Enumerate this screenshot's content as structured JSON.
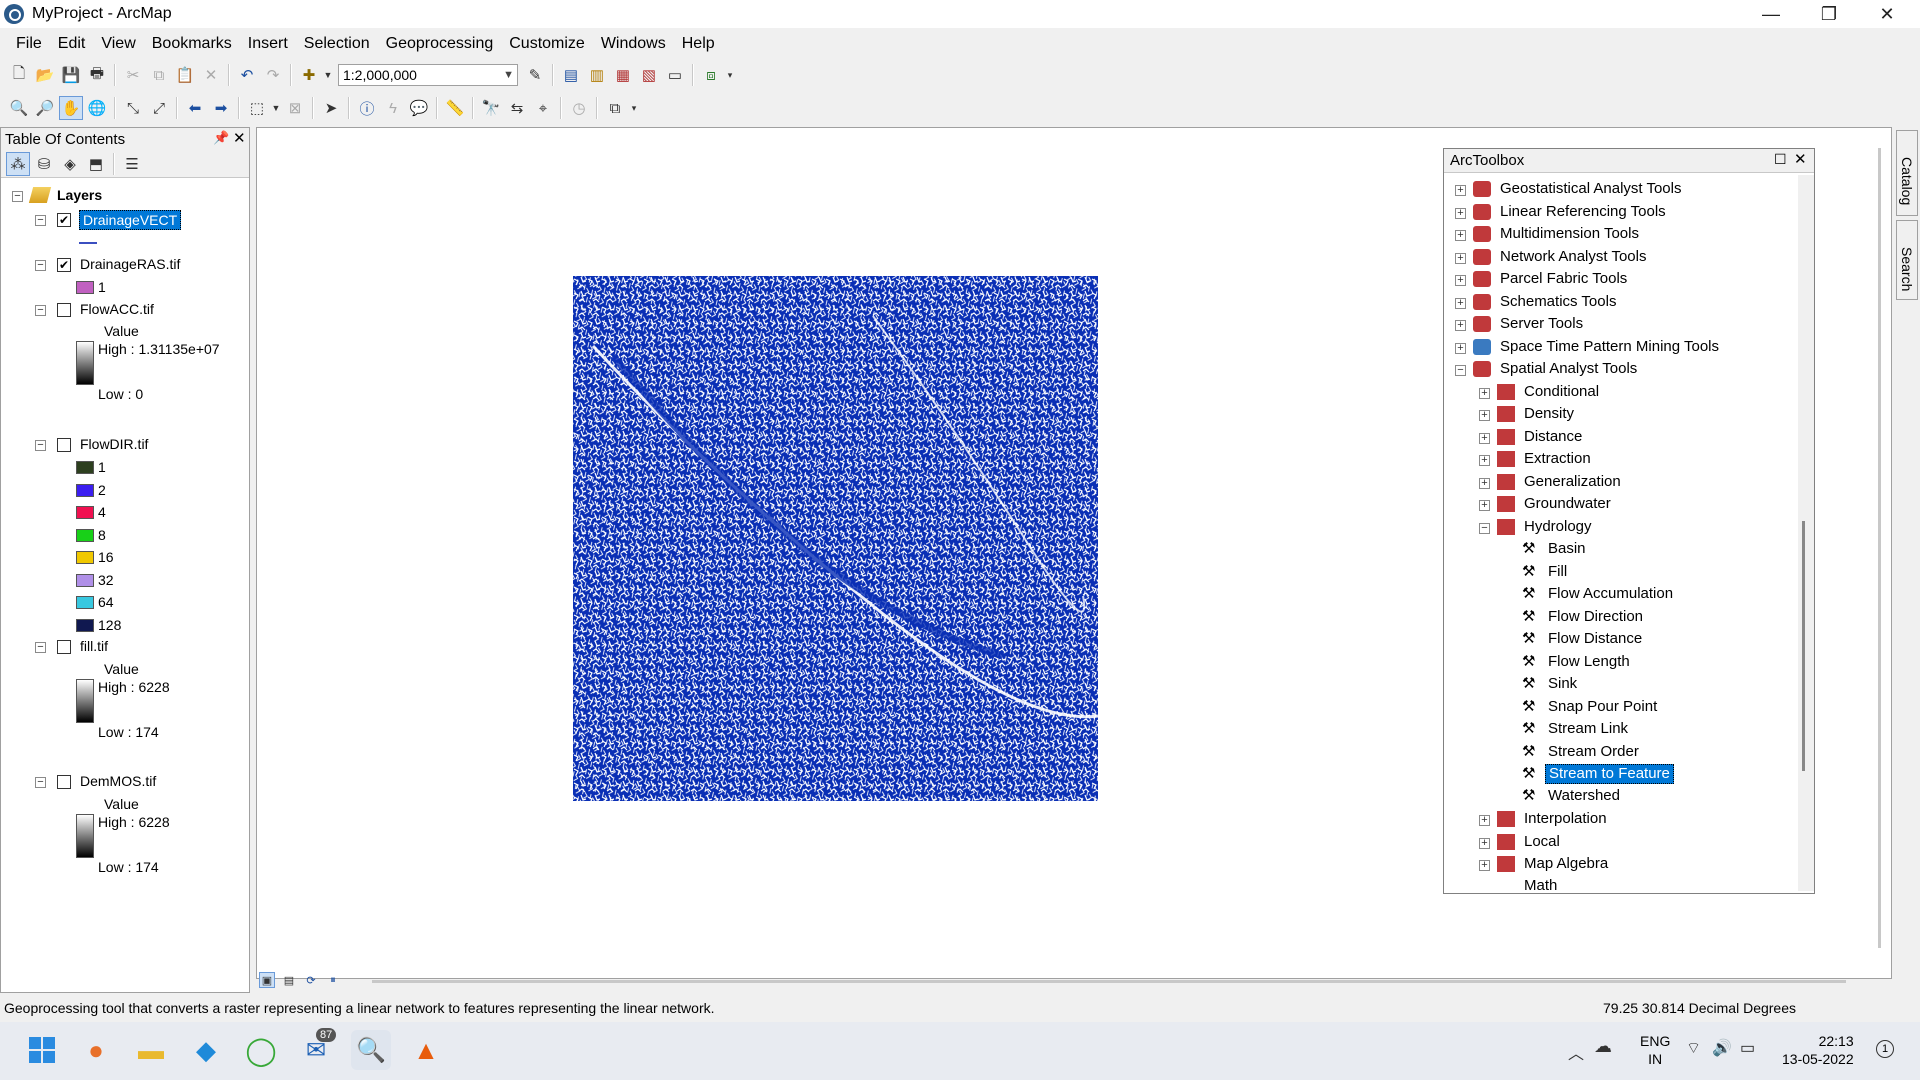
{
  "window": {
    "title": "MyProject - ArcMap",
    "minimize": "—",
    "restore": "❐",
    "close": "✕"
  },
  "menu": [
    "File",
    "Edit",
    "View",
    "Bookmarks",
    "Insert",
    "Selection",
    "Geoprocessing",
    "Customize",
    "Windows",
    "Help"
  ],
  "toolbar": {
    "scale": "1:2,000,000"
  },
  "toc": {
    "title": "Table Of Contents",
    "root": "Layers",
    "layers": [
      {
        "name": "DrainageVECT",
        "checked": true,
        "selected": true
      },
      {
        "name": "DrainageRAS.tif",
        "checked": true,
        "legend": [
          {
            "label": "1",
            "color": "#c060c0"
          }
        ]
      },
      {
        "name": "FlowACC.tif",
        "checked": false,
        "value_label": "Value",
        "high": "High : 1.31135e+07",
        "low": "Low : 0"
      },
      {
        "name": "FlowDIR.tif",
        "checked": false,
        "legend": [
          {
            "label": "1",
            "color": "#2d3f1f"
          },
          {
            "label": "2",
            "color": "#3b1ef0"
          },
          {
            "label": "4",
            "color": "#f01050"
          },
          {
            "label": "8",
            "color": "#18d018"
          },
          {
            "label": "16",
            "color": "#f0c800"
          },
          {
            "label": "32",
            "color": "#b090e8"
          },
          {
            "label": "64",
            "color": "#38c8e0"
          },
          {
            "label": "128",
            "color": "#101850"
          }
        ]
      },
      {
        "name": "fill.tif",
        "checked": false,
        "value_label": "Value",
        "high": "High : 6228",
        "low": "Low : 174"
      },
      {
        "name": "DemMOS.tif",
        "checked": false,
        "value_label": "Value",
        "high": "High : 6228",
        "low": "Low : 174"
      }
    ]
  },
  "toolbox": {
    "title": "ArcToolbox",
    "toolsets": [
      "Geostatistical Analyst Tools",
      "Linear Referencing Tools",
      "Multidimension Tools",
      "Network Analyst Tools",
      "Parcel Fabric Tools",
      "Schematics Tools",
      "Server Tools",
      "Space Time Pattern Mining Tools",
      "Spatial Analyst Tools"
    ],
    "spatial_children": [
      "Conditional",
      "Density",
      "Distance",
      "Extraction",
      "Generalization",
      "Groundwater",
      "Hydrology"
    ],
    "hydrology_tools": [
      "Basin",
      "Fill",
      "Flow Accumulation",
      "Flow Direction",
      "Flow Distance",
      "Flow Length",
      "Sink",
      "Snap Pour Point",
      "Stream Link",
      "Stream Order",
      "Stream to Feature",
      "Watershed"
    ],
    "selected_tool": "Stream to Feature",
    "after": [
      "Interpolation",
      "Local",
      "Map Algebra",
      "Math"
    ]
  },
  "side_tabs": {
    "catalog": "Catalog",
    "search": "Search"
  },
  "status": {
    "message": "Geoprocessing tool that converts a raster representing a linear network to features representing the linear network.",
    "coords": "79.25  30.814 Decimal Degrees"
  },
  "taskbar": {
    "lang1": "ENG",
    "lang2": "IN",
    "time": "22:13",
    "date": "13-05-2022",
    "badge": "87"
  },
  "colors": {
    "map_stream": "#0a2fb5",
    "selection": "#0078d7",
    "toolbox_icon": "#c0393b"
  }
}
